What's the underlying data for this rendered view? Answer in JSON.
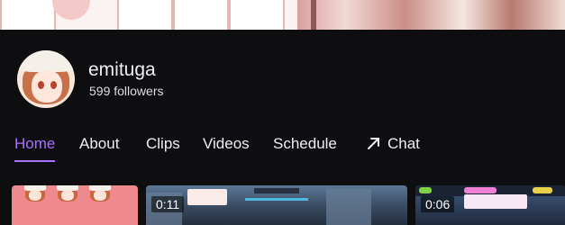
{
  "channel": {
    "name": "emituga",
    "followers": "599 followers"
  },
  "nav": {
    "tabs": [
      {
        "label": "Home",
        "active": true
      },
      {
        "label": "About",
        "active": false
      },
      {
        "label": "Clips",
        "active": false
      },
      {
        "label": "Videos",
        "active": false
      },
      {
        "label": "Schedule",
        "active": false
      }
    ],
    "chat": {
      "label": "Chat",
      "icon": "arrow-up-right-icon"
    }
  },
  "thumbnails": [
    {
      "kind": "emote-art",
      "duration": ""
    },
    {
      "kind": "video-clip",
      "duration": "0:11"
    },
    {
      "kind": "video-clip",
      "duration": "0:06"
    }
  ],
  "colors": {
    "accent": "#a970ff",
    "background": "#0e0e10",
    "text": "#efeff1"
  }
}
